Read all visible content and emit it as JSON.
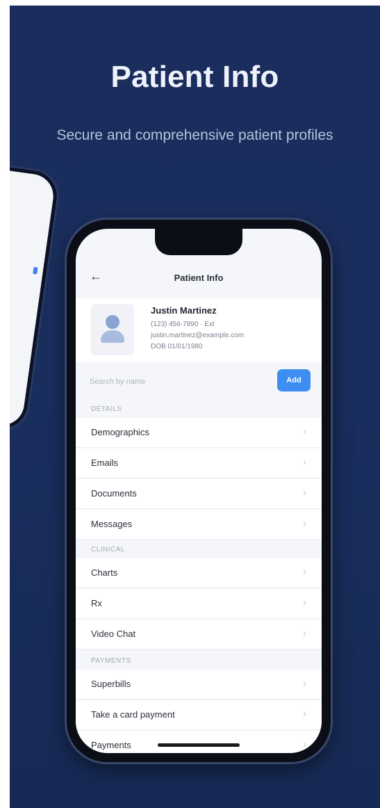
{
  "headline": "Patient Info",
  "subline": "Secure and comprehensive patient profiles",
  "screen": {
    "nav_title": "Patient Info",
    "back_icon": "←",
    "profile": {
      "name": "Justin Martinez",
      "line1": "(123) 456-7890 · Ext",
      "line2": "justin.martinez@example.com",
      "line3": "DOB 01/01/1980"
    },
    "search_placeholder": "Search by name",
    "add_label": "Add",
    "sections": [
      {
        "header": "DETAILS",
        "rows": [
          "Demographics",
          "Emails",
          "Documents",
          "Messages"
        ]
      },
      {
        "header": "CLINICAL",
        "rows": [
          "Charts",
          "Rx",
          "Video Chat"
        ]
      },
      {
        "header": "PAYMENTS",
        "rows": [
          "Superbills",
          "Take a card payment",
          "Payments"
        ]
      }
    ],
    "chevron": "›"
  },
  "colors": {
    "background": "#1a2d5c",
    "accent": "#3d8ef0"
  }
}
